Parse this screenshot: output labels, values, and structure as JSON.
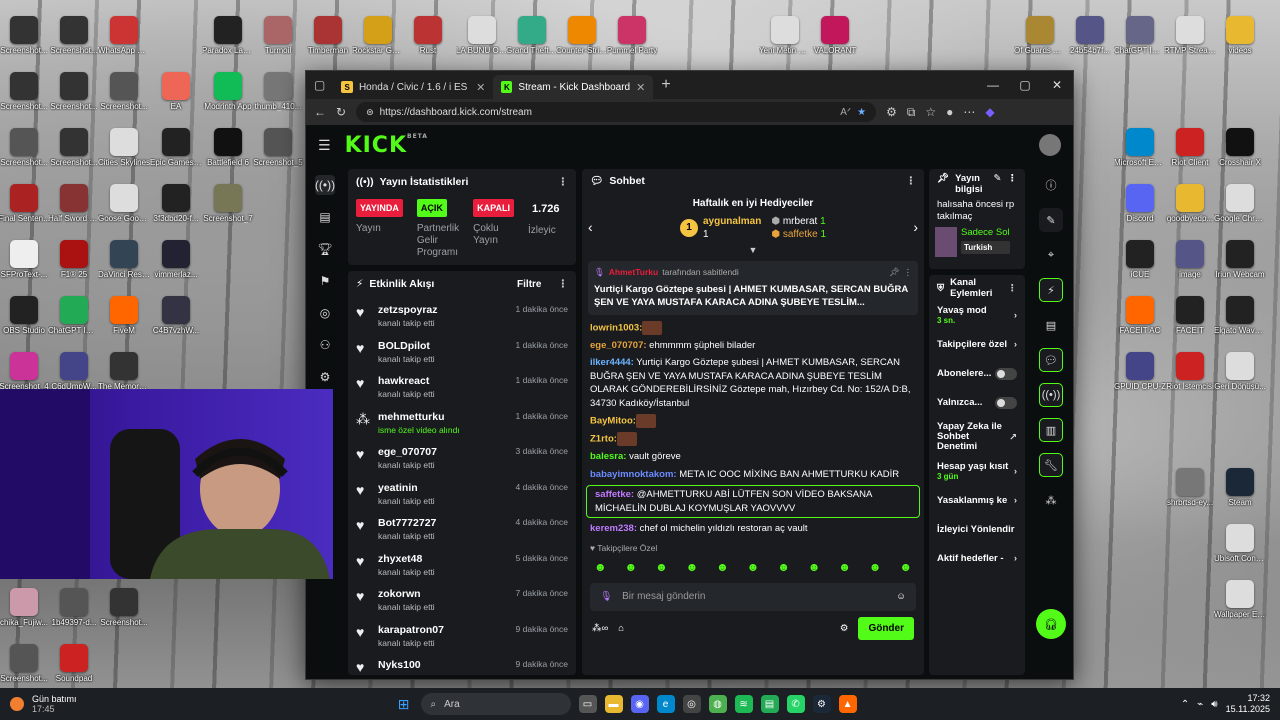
{
  "desktop": {
    "icons": [
      {
        "label": "Screenshot...",
        "color": "#333"
      },
      {
        "label": "Screenshot...",
        "color": "#333"
      },
      {
        "label": "WhatsApp Görsel 2025...",
        "color": "#c33"
      },
      {
        "label": "Paradox Launcher v2",
        "color": "#222"
      },
      {
        "label": "Turmoil",
        "color": "#a66"
      },
      {
        "label": "Timberman",
        "color": "#a33"
      },
      {
        "label": "Rockstar Games ...",
        "color": "#d4a017"
      },
      {
        "label": "Rust",
        "color": "#b33"
      },
      {
        "label": "LA BUNU OKU",
        "color": "#ddd"
      },
      {
        "label": "Grand Theft Auto V En...",
        "color": "#3a8"
      },
      {
        "label": "Counter-Stri... 2",
        "color": "#e80"
      },
      {
        "label": "Pummel Party",
        "color": "#c36"
      },
      {
        "label": "Yeni Metin Belgesi",
        "color": "#ddd"
      },
      {
        "label": "VALORANT",
        "color": "#c2185b"
      },
      {
        "label": "Screenshot...",
        "color": "#333"
      },
      {
        "label": "Screenshot...",
        "color": "#333"
      },
      {
        "label": "Screenshot...",
        "color": "#555"
      },
      {
        "label": "EA",
        "color": "#e65"
      },
      {
        "label": "Modrinth App",
        "color": "#1b5"
      },
      {
        "label": "thumb_410...",
        "color": "#777"
      },
      {
        "label": "Screenshot...",
        "color": "#555"
      },
      {
        "label": "Screenshot...",
        "color": "#333"
      },
      {
        "label": "Cities Skylines",
        "color": "#ddd"
      },
      {
        "label": "Epic Games Launcher",
        "color": "#222"
      },
      {
        "label": "Battlefield 6",
        "color": "#111"
      },
      {
        "label": "Screenshot_5",
        "color": "#555"
      },
      {
        "label": "Final Senten...",
        "color": "#a22"
      },
      {
        "label": "Half Sword Demo",
        "color": "#833"
      },
      {
        "label": "Goose Goose Duck",
        "color": "#ddd"
      },
      {
        "label": "3f3dbd20-f...",
        "color": "#222"
      },
      {
        "label": "Screenshot_7",
        "color": "#775"
      },
      {
        "label": "SFProText-...",
        "color": "#eee"
      },
      {
        "label": "F1® 25",
        "color": "#a11"
      },
      {
        "label": "DaVinci Resolve",
        "color": "#345"
      },
      {
        "label": "vimmerlaz...",
        "color": "#223"
      },
      {
        "label": "OBS Studio",
        "color": "#222"
      },
      {
        "label": "ChatGPT Image 15 E...",
        "color": "#2a5"
      },
      {
        "label": "FiveM",
        "color": "#f60"
      },
      {
        "label": "C4B7vzhW...",
        "color": "#334"
      },
      {
        "label": "Screenshot_4",
        "color": "#c39"
      },
      {
        "label": "C6dUmpW...",
        "color": "#448"
      },
      {
        "label": "The Memory Thieves",
        "color": "#333"
      },
      {
        "label": "Screenshot...",
        "color": "#555"
      },
      {
        "label": "Soundpad",
        "color": "#c22"
      },
      {
        "label": "Of Guards And Thieves",
        "color": "#a83"
      },
      {
        "label": "24b54b7f...",
        "color": "#558"
      },
      {
        "label": "ChatGPT Image 16 E...",
        "color": "#668"
      },
      {
        "label": "RTMP Stream Server",
        "color": "#ddd"
      },
      {
        "label": "videos",
        "color": "#e8b830"
      },
      {
        "label": "Microsoft Edge",
        "color": "#08c"
      },
      {
        "label": "Riot Client",
        "color": "#c22"
      },
      {
        "label": "Crosshair X",
        "color": "#111"
      },
      {
        "label": "Discord",
        "color": "#5865f2"
      },
      {
        "label": "goodbyedp...",
        "color": "#e8b830"
      },
      {
        "label": "Google Chrome",
        "color": "#ddd"
      },
      {
        "label": "iCUE",
        "color": "#222"
      },
      {
        "label": "image",
        "color": "#558"
      },
      {
        "label": "Iriun Webcam",
        "color": "#222"
      },
      {
        "label": "FACEIT AC",
        "color": "#f60"
      },
      {
        "label": "FACEIT",
        "color": "#222"
      },
      {
        "label": "Elgato Wave Link",
        "color": "#222"
      },
      {
        "label": "GPUID CPU-Z",
        "color": "#448"
      },
      {
        "label": "Riot İstemcisi",
        "color": "#c22"
      },
      {
        "label": "Geri Dönüşü...",
        "color": "#ddd"
      },
      {
        "label": "shrbrtsd-ey...",
        "color": "#777"
      },
      {
        "label": "Steam",
        "color": "#1b2838"
      },
      {
        "label": "Ubisoft Connect",
        "color": "#ddd"
      },
      {
        "label": "Wallpaper Engine",
        "color": "#ddd"
      },
      {
        "label": "chika_Fujiw...",
        "color": "#c9a"
      },
      {
        "label": "1b49397-d...",
        "color": "#555"
      },
      {
        "label": "Screenshot...",
        "color": "#333"
      }
    ]
  },
  "browser": {
    "tabs": [
      {
        "label": "Honda / Civic / 1.6 / i ES / Kup10",
        "favicon": "S"
      },
      {
        "label": "Stream - Kick Dashboard",
        "favicon": "K"
      }
    ],
    "url": "https://dashboard.kick.com/stream"
  },
  "kick": {
    "logo": "KICK",
    "beta": "BETA",
    "stats": {
      "title": "Yayın İstatistikleri",
      "items": [
        {
          "badge": "YAYINDA",
          "badge_color": "#e91e3c",
          "label": "Yayın"
        },
        {
          "badge": "AÇIK",
          "badge_color": "#53fc18",
          "label": "Partnerlik Gelir Programı"
        },
        {
          "badge": "KAPALI",
          "badge_color": "#e91e3c",
          "label": "Çoklu Yayın"
        },
        {
          "badge": "1.726",
          "badge_color": "",
          "label": "İzleyic"
        }
      ]
    },
    "activity": {
      "title": "Etkinlik Akışı",
      "filter": "Filtre",
      "items": [
        {
          "name": "zetzspoyraz",
          "sub": "kanalı takip etti",
          "time": "1 dakika önce"
        },
        {
          "name": "BOLDpilot",
          "sub": "kanalı takip etti",
          "time": "1 dakika önce"
        },
        {
          "name": "hawkreact",
          "sub": "kanalı takip etti",
          "time": "1 dakika önce"
        },
        {
          "name": "mehmetturku",
          "sub": "isme özel video alındı",
          "time": "1 dakika önce"
        },
        {
          "name": "ege_070707",
          "sub": "kanalı takip etti",
          "time": "3 dakika önce"
        },
        {
          "name": "yeatinin",
          "sub": "kanalı takip etti",
          "time": "4 dakika önce"
        },
        {
          "name": "Bot7772727",
          "sub": "kanalı takip etti",
          "time": "4 dakika önce"
        },
        {
          "name": "zhyxet48",
          "sub": "kanalı takip etti",
          "time": "5 dakika önce"
        },
        {
          "name": "zokorwn",
          "sub": "kanalı takip etti",
          "time": "7 dakika önce"
        },
        {
          "name": "karapatron07",
          "sub": "kanalı takip etti",
          "time": "9 dakika önce"
        },
        {
          "name": "Nyks100",
          "sub": "",
          "time": "9 dakika önce"
        }
      ]
    },
    "chat": {
      "title": "Sohbet",
      "top_gifters_title": "Haftalık en iyi Hediyeciler",
      "gifters": [
        {
          "rank": "1",
          "name": "aygunalman",
          "count": "1"
        },
        {
          "rank": "2",
          "name": "mrberat",
          "count": "1"
        },
        {
          "rank": "3",
          "name": "saffetke",
          "count": "1"
        }
      ],
      "pinned_by": "AhmetTurku",
      "pinned_suffix": "tarafından sabitlendi",
      "pinned_text": "Yurtiçi Kargo Göztepe şubesi | AHMET KUMBASAR, SERCAN BUĞRA ŞEN VE YAYA MUSTAFA KARACA ADINA ŞUBEYE TESLİM...",
      "messages": [
        {
          "user": "lowrin1003:",
          "color": "#f5c542",
          "text": ""
        },
        {
          "user": "ege_070707:",
          "color": "#e8a33c",
          "text": " ehmmmm şüpheli bilader"
        },
        {
          "user": "ilker4444:",
          "color": "#6cb4ff",
          "text": " Yurtiçi Kargo Göztepe şubesi | AHMET KUMBASAR, SERCAN BUĞRA ŞEN VE YAYA MUSTAFA KARACA ADINA ŞUBEYE TESLİM OLARAK GÖNDEREBİLİRSİNİZ Göztepe mah, Hızırbey Cd. No: 152/A D:B, 34730 Kadıköy/İstanbul"
        },
        {
          "user": "BayMitoo:",
          "color": "#f5c542",
          "text": ""
        },
        {
          "user": "Z1rto:",
          "color": "#f5c542",
          "text": ""
        },
        {
          "user": "balesra:",
          "color": "#53fc18",
          "text": " vault göreve"
        },
        {
          "user": "babayimnoktakom:",
          "color": "#6c8cff",
          "text": " META IC OOC MİXİNG BAN AHMETTURKU KADİR"
        },
        {
          "user": "saffetke:",
          "color": "#c07bff",
          "text": " @AHMETTURKU ABİ LÜTFEN SON VİDEO BAKSANA MİCHAELİN DUBLAJ KOYMUŞLAR YAOVVVV"
        },
        {
          "user": "kerem238:",
          "color": "#c07bff",
          "text": " chef ol michelin yıldızlı restoran aç vault"
        }
      ],
      "followers_only": "Takipçilere Özel",
      "input_placeholder": "Bir mesaj gönderin",
      "send": "Gönder"
    },
    "stream_info": {
      "title": "Yayın bilgisi",
      "stream_title": "halısaha öncesi rp takılmaç",
      "category": "Sadece Sol",
      "tag": "Turkish"
    },
    "channel_actions": {
      "title": "Kanal Eylemleri",
      "items": [
        {
          "label": "Yavaş mod",
          "sub": "3 sn.",
          "type": "arrow"
        },
        {
          "label": "Takipçilere özel",
          "sub": "",
          "type": "arrow"
        },
        {
          "label": "Abonelere...",
          "sub": "",
          "type": "toggle"
        },
        {
          "label": "Yalnızca...",
          "sub": "",
          "type": "toggle"
        },
        {
          "label": "Yapay Zeka ile Sohbet Denetimi",
          "sub": "",
          "type": "ext"
        },
        {
          "label": "Hesap yaşı kısıt",
          "sub": "3 gün",
          "type": "arrow"
        },
        {
          "label": "Yasaklanmış ke",
          "sub": "",
          "type": "arrow"
        },
        {
          "label": "İzleyici Yönlendir",
          "sub": "",
          "type": "none"
        },
        {
          "label": "Aktif hedefler -",
          "sub": "",
          "type": "arrow"
        }
      ]
    }
  },
  "taskbar": {
    "weather_title": "Gün batımı",
    "weather_time": "17:45",
    "search": "Ara",
    "time": "17:32",
    "date": "15.11.2025"
  }
}
